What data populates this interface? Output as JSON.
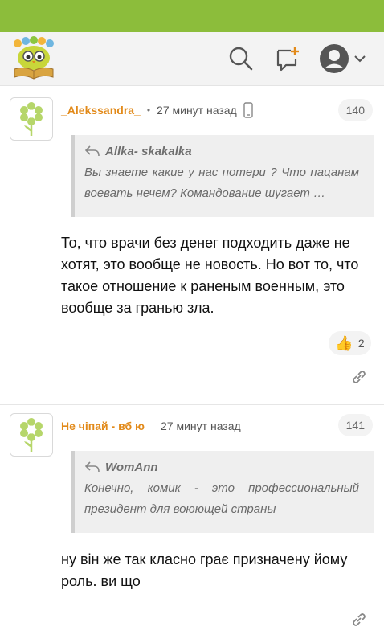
{
  "colors": {
    "statusbar": "#8cbd3b",
    "author": "#e28a1a",
    "header_bg": "#f3f3f3"
  },
  "header": {
    "logo_icon": "owl-on-book-logo",
    "search_icon": "search-icon",
    "new_post_icon": "new-post-icon",
    "account_icon": "account-avatar-icon",
    "dropdown_icon": "chevron-down-icon"
  },
  "comments": [
    {
      "avatar_icon": "flower-avatar-icon",
      "author": "_Alekssandra_",
      "separator": "•",
      "time": "27 минут назад",
      "device_icon": "mobile-phone-icon",
      "number": "140",
      "quote": {
        "author": "Allka- skakalka",
        "text": "Вы знаете какие у нас потери ? Что пацанам воевать нечем? Командование шугает …"
      },
      "text": "То, что врачи без денег подходить даже не хотят, это вообще не новость. Но вот то, что такое отношение к раненым военным, это вообще за гранью зла.",
      "likes": "2",
      "like_icon": "thumbs-up-icon",
      "link_icon": "link-icon"
    },
    {
      "avatar_icon": "flower-avatar-icon",
      "author": "Не чіпай - вб ю",
      "time": "27 минут назад",
      "number": "141",
      "quote": {
        "author": "WomAnn",
        "text": "Конечно, комик - это профессиональный президент для воюющей страны"
      },
      "text": "ну він же так класно грає призначену йому роль. ви що",
      "link_icon": "link-icon"
    }
  ]
}
